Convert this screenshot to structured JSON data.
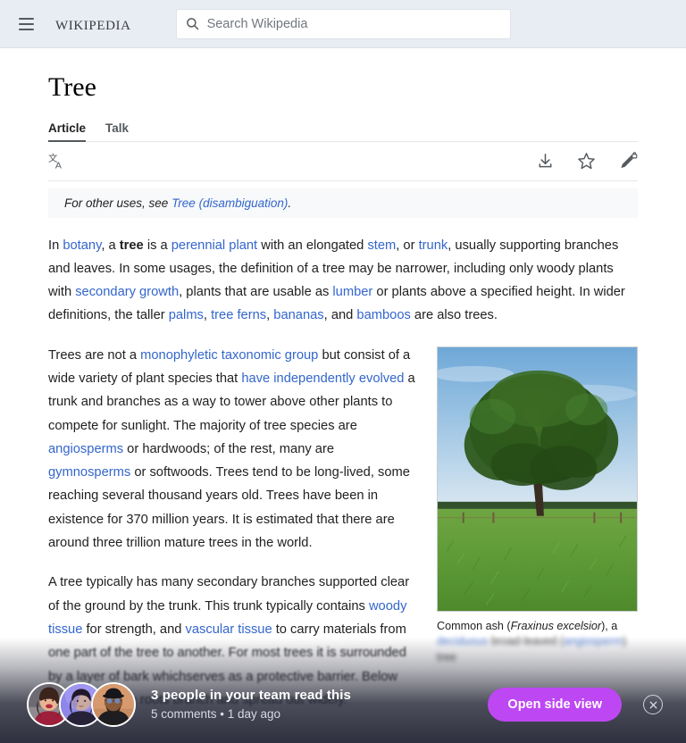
{
  "header": {
    "menu_icon": "hamburger-menu-icon",
    "wordmark": "Wikipedia",
    "search": {
      "icon": "search-icon",
      "placeholder": "Search Wikipedia",
      "value": ""
    }
  },
  "article": {
    "title": "Tree",
    "tabs": [
      {
        "label": "Article",
        "active": true
      },
      {
        "label": "Talk",
        "active": false
      }
    ],
    "toolbar": {
      "language_icon": "language-icon",
      "download_icon": "download-icon",
      "watch_icon": "star-icon",
      "edit_icon": "pencil-lock-icon"
    },
    "hatnote": {
      "prefix": "For other uses, see ",
      "link": "Tree (disambiguation)",
      "suffix": "."
    },
    "paragraphs": {
      "p1": {
        "s1": "In ",
        "l1": "botany",
        "s2": ", a ",
        "b1": "tree",
        "s3": " is a ",
        "l2": "perennial plant",
        "s4": " with an elongated ",
        "l3": "stem",
        "s5": ", or ",
        "l4": "trunk",
        "s6": ", usually supporting branches and leaves. In some usages, the definition of a tree may be narrower, including only woody plants with ",
        "l5": "secondary growth",
        "s7": ", plants that are usable as ",
        "l6": "lumber",
        "s8": " or plants above a specified height. In wider definitions, the taller ",
        "l7": "palms",
        "s9": ", ",
        "l8": "tree ferns",
        "s10": ", ",
        "l9": "bananas",
        "s11": ", and ",
        "l10": "bamboos",
        "s12": " are also trees."
      },
      "p2": {
        "s1": "Trees are not a ",
        "l1": "monophyletic taxonomic group",
        "s2": " but consist of a wide variety of plant species that ",
        "l2": "have independently evolved",
        "s3": " a trunk and branches as a way to tower above other plants to compete for sunlight. The majority of tree species are ",
        "l3": "angiosperms",
        "s4": " or hardwoods; of the rest, many are ",
        "l4": "gymnosperms",
        "s5": " or softwoods. Trees tend to be long-lived, some reaching several thousand years old. Trees have been in existence for 370 million years. It is estimated that there are around three trillion mature trees in the world."
      },
      "p3": {
        "s1": "A tree typically has many secondary branches supported clear of the ground by the trunk. This trunk typically contains ",
        "l1": "woody tissue",
        "s2": " for strength, and ",
        "l2": "vascular tissue",
        "s3": " to carry materials from one part of the tree to another. For most trees it is surrounded by a layer of bark which"
      },
      "p4": {
        "s1": "serves as a protective barrier. Below the ground, the roots branch and spread out widely."
      }
    },
    "figure": {
      "image_name": "common-ash-tree-photo",
      "caption": {
        "s1": "Common ash (",
        "i1": "Fraxinus excelsior",
        "s2": "), a ",
        "l1": "deciduous",
        "s3": " broad-leaved (",
        "l2": "angiosperm",
        "s4": ") tree"
      }
    }
  },
  "notification": {
    "avatars": [
      {
        "name": "avatar-person-1"
      },
      {
        "name": "avatar-person-2"
      },
      {
        "name": "avatar-person-3"
      }
    ],
    "title": "3 people in your team read this",
    "subtitle": "5 comments • 1 day ago",
    "primary_button": "Open side view",
    "close_icon": "close-icon"
  },
  "colors": {
    "header_bg": "#e8ecf3",
    "link": "#3366cc",
    "accent_purple": "#bd47f2",
    "text": "#202122",
    "hatnote_bg": "#f8f9fa"
  }
}
